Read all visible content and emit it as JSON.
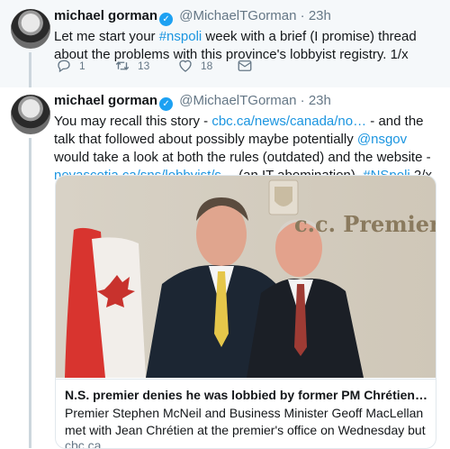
{
  "tweet1": {
    "name": "michael gorman",
    "handle": "@MichaelTGorman",
    "separator": "·",
    "time": "23h",
    "text_parts": [
      "Let me start your ",
      "#nspoli",
      " week with a brief (I promise) thread about the problems with this province's lobbyist registry. 1/x"
    ],
    "replies": "1",
    "retweets": "13",
    "likes": "18"
  },
  "tweet2": {
    "name": "michael gorman",
    "handle": "@MichaelTGorman",
    "separator": "·",
    "time": "23h",
    "text_parts": [
      "You may recall this story - ",
      "cbc.ca/news/canada/no…",
      " - and the talk that followed about possibly maybe potentially ",
      "@nsgov",
      " would take a look at both the rules (outdated) and the website - ",
      "novascotia.ca/sns/lobbyist/s…",
      " (an IT abomination). ",
      "#NSpoli",
      " 2/x"
    ],
    "card": {
      "sign_text": "c.c. Premier",
      "title": "N.S. premier denies he was lobbied by former PM Chrétien | CBC …",
      "description": "Premier Stephen McNeil and Business Minister Geoff MacLellan met with Jean Chrétien at the premier's office on Wednesday but both men deny",
      "domain": "cbc.ca"
    }
  },
  "icons": {
    "reply": "reply-icon",
    "retweet": "retweet-icon",
    "like": "heart-icon",
    "message": "envelope-icon",
    "verified": "verified-badge-icon"
  },
  "colors": {
    "link": "#1b95e0",
    "verified": "#1da1f2",
    "muted": "#657786"
  }
}
